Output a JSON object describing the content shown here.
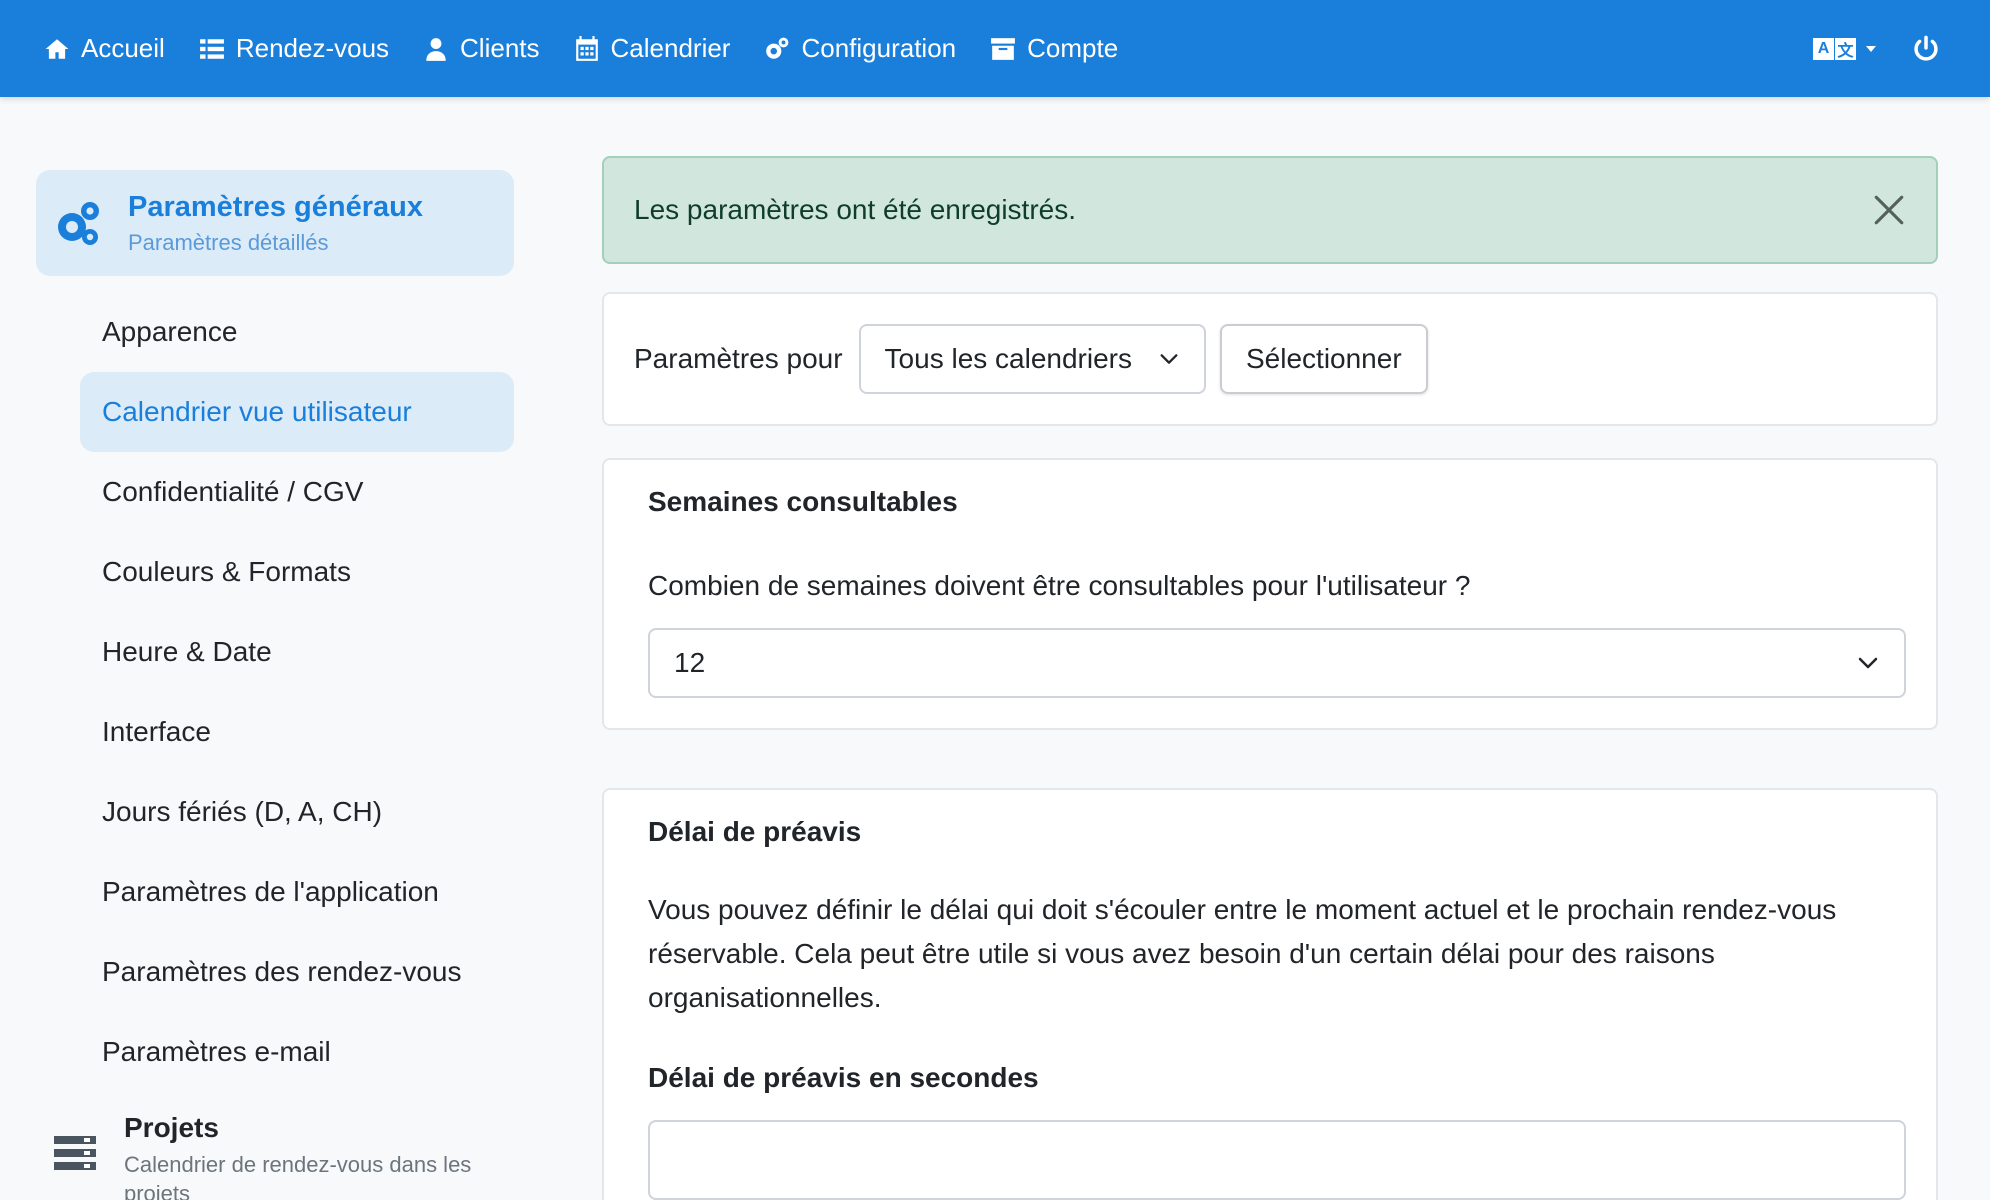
{
  "nav": {
    "items": [
      {
        "label": "Accueil",
        "icon": "home-icon"
      },
      {
        "label": "Rendez-vous",
        "icon": "list-icon"
      },
      {
        "label": "Clients",
        "icon": "user-icon"
      },
      {
        "label": "Calendrier",
        "icon": "calendar-icon"
      },
      {
        "label": "Configuration",
        "icon": "gears-icon"
      },
      {
        "label": "Compte",
        "icon": "archive-icon"
      }
    ],
    "lang_left": "A",
    "lang_right": "文",
    "accent_color": "#1a7fda"
  },
  "sidebar": {
    "header_title": "Paramètres généraux",
    "header_subtitle": "Paramètres détaillés",
    "items": [
      {
        "label": "Apparence",
        "active": false
      },
      {
        "label": "Calendrier vue utilisateur",
        "active": true
      },
      {
        "label": "Confidentialité / CGV",
        "active": false
      },
      {
        "label": "Couleurs & Formats",
        "active": false
      },
      {
        "label": "Heure & Date",
        "active": false
      },
      {
        "label": "Interface",
        "active": false
      },
      {
        "label": "Jours fériés (D, A, CH)",
        "active": false
      },
      {
        "label": "Paramètres de l'application",
        "active": false
      },
      {
        "label": "Paramètres des rendez-vous",
        "active": false
      },
      {
        "label": "Paramètres e-mail",
        "active": false
      }
    ],
    "footer_title": "Projets",
    "footer_subtitle": "Calendrier de rendez-vous dans les projets"
  },
  "alert": {
    "text": "Les paramètres ont été enregistrés.",
    "color": "#d1e7dd"
  },
  "settings_for": {
    "label": "Paramètres pour",
    "selected": "Tous les calendriers",
    "button": "Sélectionner"
  },
  "weeks": {
    "title": "Semaines consultables",
    "question": "Combien de semaines doivent être consultables pour l'utilisateur ?",
    "value": "12"
  },
  "delay": {
    "title": "Délai de préavis",
    "description": "Vous pouvez définir le délai qui doit s'écouler entre le moment actuel et le prochain rendez-vous réservable. Cela peut être utile si vous avez besoin d'un certain délai pour des raisons organisationnelles.",
    "field_label": "Délai de préavis en secondes",
    "field_value": ""
  }
}
